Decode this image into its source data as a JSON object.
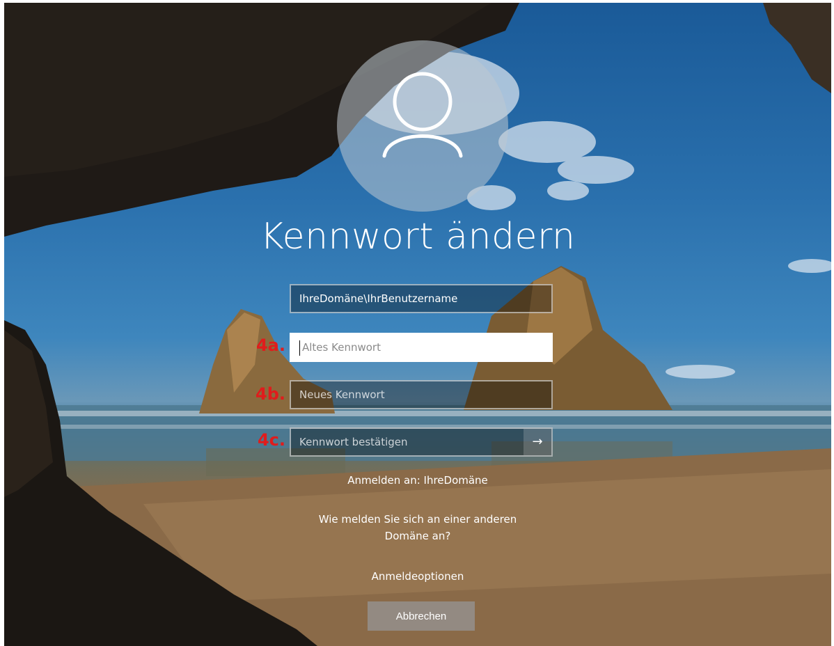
{
  "title": "Kennwort ändern",
  "fields": {
    "username_value": "IhreDomäne\\IhrBenutzername",
    "old_password_placeholder": "Altes Kennwort",
    "new_password_placeholder": "Neues Kennwort",
    "confirm_password_placeholder": "Kennwort bestätigen"
  },
  "steps": {
    "a": "4a.",
    "b": "4b.",
    "c": "4c."
  },
  "sign_in_to": "Anmelden an: IhreDomäne",
  "other_domain_line1": "Wie melden Sie sich an einer anderen",
  "other_domain_line2": "Domäne an?",
  "sign_in_options": "Anmeldeoptionen",
  "cancel_label": "Abbrechen",
  "icons": {
    "avatar": "user-icon",
    "submit": "arrow-right-icon"
  },
  "colors": {
    "step_annotation": "#e01c1c"
  }
}
